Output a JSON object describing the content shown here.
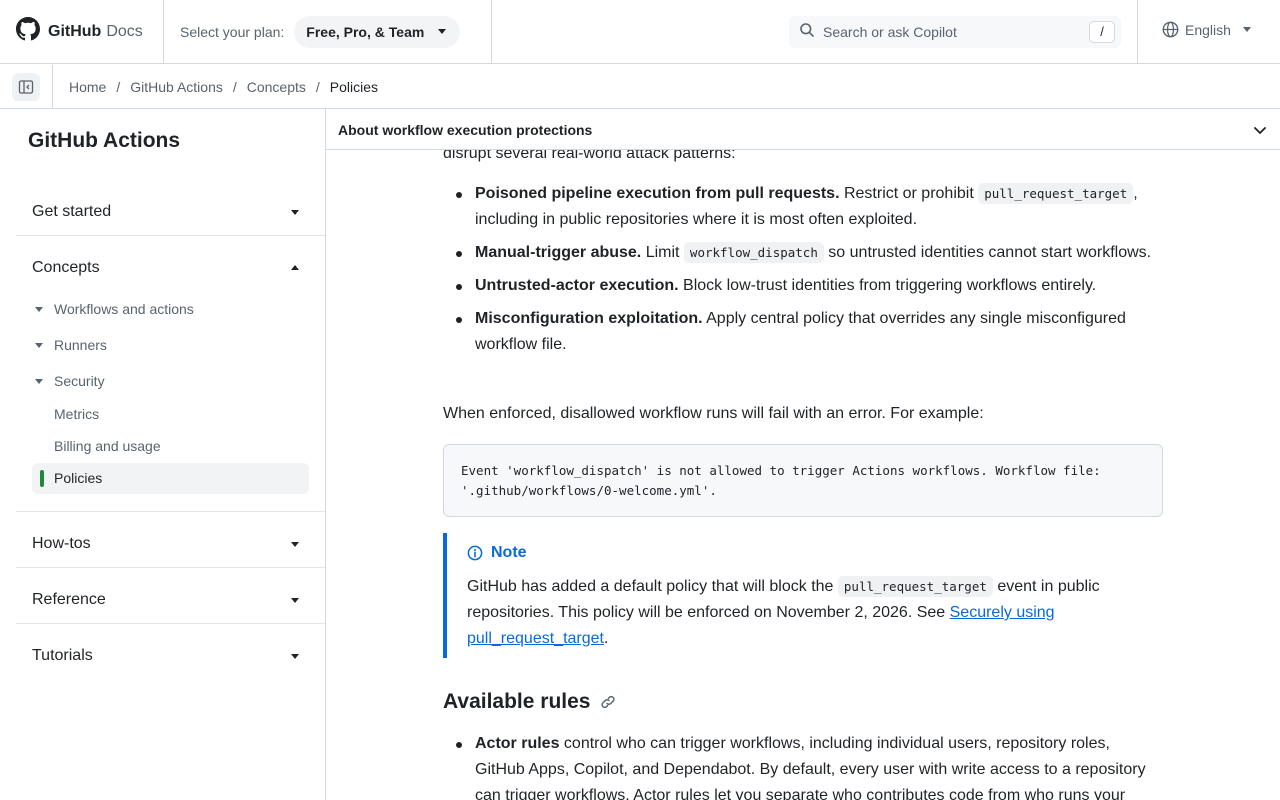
{
  "header": {
    "brand_primary": "GitHub",
    "brand_secondary": "Docs",
    "plan_label": "Select your plan:",
    "plan_value": "Free, Pro, & Team",
    "search_placeholder": "Search or ask Copilot",
    "search_shortcut": "/",
    "language": "English"
  },
  "breadcrumb": [
    {
      "label": "Home"
    },
    {
      "label": "GitHub Actions"
    },
    {
      "label": "Concepts"
    },
    {
      "label": "Policies"
    }
  ],
  "breadcrumb_separator": "/",
  "sidebar": {
    "title": "GitHub Actions",
    "sections": [
      {
        "label": "Get started",
        "expanded": false
      },
      {
        "label": "Concepts",
        "expanded": true
      },
      {
        "label": "How-tos",
        "expanded": false
      },
      {
        "label": "Reference",
        "expanded": false
      },
      {
        "label": "Tutorials",
        "expanded": false
      }
    ],
    "concepts_items": [
      {
        "label": "Workflows and actions"
      },
      {
        "label": "Runners"
      },
      {
        "label": "Security"
      },
      {
        "label": "Metrics"
      },
      {
        "label": "Billing and usage"
      },
      {
        "label": "Policies"
      }
    ]
  },
  "toc": {
    "current": "About workflow execution protections"
  },
  "content": {
    "fragment": "disrupt several real-world attack patterns:",
    "bullets": [
      {
        "strong": "Poisoned pipeline execution from pull requests.",
        "pre": " Restrict or prohibit ",
        "code": "pull_request_target",
        "post": ", including in public repositories where it is most often exploited."
      },
      {
        "strong": "Manual-trigger abuse.",
        "pre": " Limit ",
        "code": "workflow_dispatch",
        "post": " so untrusted identities cannot start workflows."
      },
      {
        "strong": "Untrusted-actor execution.",
        "pre": " Block low-trust identities from triggering workflows entirely.",
        "code": "",
        "post": ""
      },
      {
        "strong": "Misconfiguration exploitation.",
        "pre": " Apply central policy that overrides any single misconfigured workflow file.",
        "code": "",
        "post": ""
      }
    ],
    "enforced_text": "When enforced, disallowed workflow runs will fail with an error. For example:",
    "code_block": "Event 'workflow_dispatch' is not allowed to trigger Actions workflows. Workflow file: '.github/workflows/0-welcome.yml'.",
    "note": {
      "title": "Note",
      "pre": "GitHub has added a default policy that will block the ",
      "code": "pull_request_target",
      "mid": " event in public repositories. This policy will be enforced on November 2, 2026. See ",
      "link": "Securely using pull_request_target",
      "post": "."
    },
    "heading": "Available rules",
    "rules": [
      {
        "strong": "Actor rules",
        "text": " control who can trigger workflows, including individual users, repository roles, GitHub Apps, Copilot, and Dependabot. By default, every user with write access to a repository can trigger workflows. Actor rules let you separate who contributes code from who runs your"
      }
    ]
  },
  "colors": {
    "accent": "#0969da",
    "active_marker": "#1f883d",
    "text": "#1f2328",
    "muted": "#59636e"
  },
  "icons": [
    "github-logo-icon",
    "search-icon",
    "globe-icon",
    "sidebar-toggle-icon",
    "chevron-down-icon",
    "info-icon",
    "link-icon"
  ]
}
